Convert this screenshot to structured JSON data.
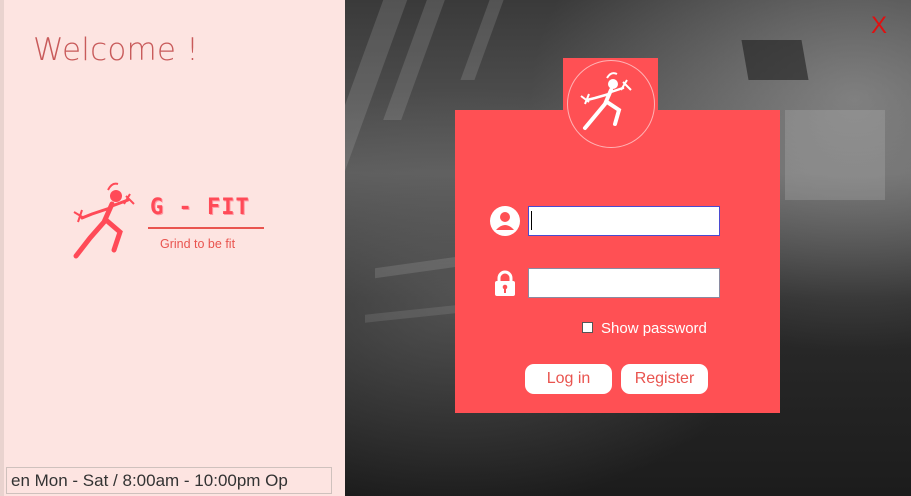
{
  "sidebar": {
    "welcome": "Welcome !",
    "brand_name": "G - FIT",
    "tagline": "Grind to be fit",
    "hours_ticker": "en Mon - Sat / 8:00am - 10:00pm Op"
  },
  "window": {
    "close_label": "X"
  },
  "login": {
    "username_value": "",
    "password_value": "",
    "show_password_label": "Show password",
    "show_password_checked": false,
    "login_label": "Log in",
    "register_label": "Register"
  },
  "icons": {
    "logo": "runner-dumbbells-icon",
    "username": "user-icon",
    "password": "lock-icon"
  },
  "colors": {
    "sidebar_bg": "#fde4e1",
    "card_bg": "#ff5054",
    "accent": "#e9544f",
    "close": "#e01010"
  }
}
